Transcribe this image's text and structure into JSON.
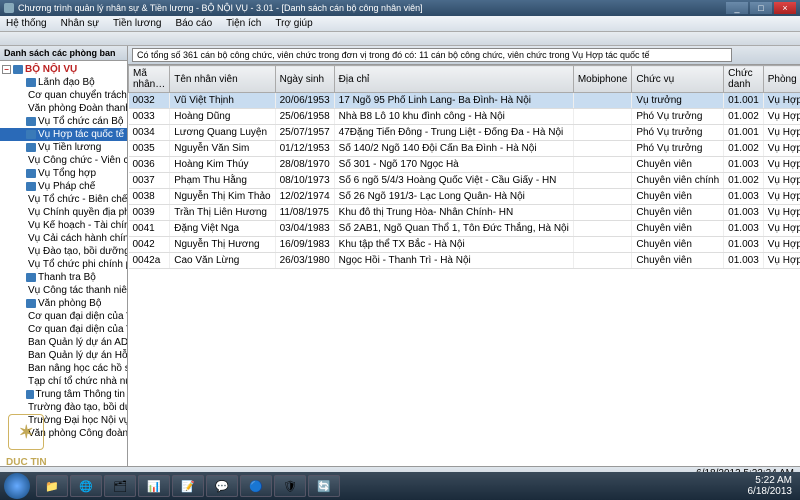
{
  "window": {
    "title": "Chương trình quản lý nhân sự & Tiền lương - BỘ NỘI VỤ - 3.01 - [Danh sách cán bộ công nhân viên]"
  },
  "menu": [
    "Hệ thống",
    "Nhân sự",
    "Tiền lương",
    "Báo cáo",
    "Tiện ích",
    "Trợ giúp"
  ],
  "sidebar": {
    "header": "Danh sách các phòng ban",
    "root": "BỘ NỘI VỤ",
    "items": [
      "Lãnh đạo Bộ",
      "Cơ quan chuyển trách của",
      "Văn phòng Đoàn thanh ni",
      "Vụ Tổ chức cán Bộ",
      "Vụ Hợp tác quốc tế",
      "Vụ Tiền lương",
      "Vụ Công chức - Viên chức",
      "Vụ Tổng hợp",
      "Vụ Pháp chế",
      "Vụ Tổ chức - Biên chế",
      "Vụ Chính quyền địa phươn",
      "Vụ Kế hoạch - Tài chính",
      "Vụ Cải cách hành chính",
      "Vụ Đào tạo, bồi dưỡng cá",
      "Vụ Tổ chức phi chính phủ",
      "Thanh tra Bộ",
      "Vụ Công tác thanh niên",
      "Văn phòng Bộ",
      "Cơ quan đại diện của Văn p",
      "Cơ quan đại diện của Văn p",
      "Ban Quản lý dự án ADB",
      "Ban Quản lý dự án Hỗ trợ n",
      "Ban nâng học các hồ sơ h",
      "Tạp chí tổ chức nhà nước",
      "Trung tâm Thông tin",
      "Trường đào tạo, bồi dưỡn",
      "Trường Đại học Nội vụ Hà",
      "Văn phòng Công đoàn Bộ"
    ],
    "selected_index": 4
  },
  "filter": {
    "text": "Có tổng số 361 cán bộ công chức, viên chức trong đơn vị trong đó có: 11 cán bộ công chức, viên chức trong Vụ Hợp tác quốc tế"
  },
  "grid": {
    "columns": [
      "Mã nhân…",
      "Tên nhân viên",
      "Ngày sinh",
      "Địa chỉ",
      "Mobiphone",
      "Chức vụ",
      "Chức danh",
      "Phòng ban"
    ],
    "rows": [
      {
        "id": "0032",
        "name": "Vũ Việt Thịnh",
        "dob": "20/06/1953",
        "addr": "17 Ngõ 95 Phố Linh Lang- Ba Đình- Hà Nội",
        "mob": "",
        "pos": "Vụ trưởng",
        "rank": "01.001",
        "dept": "Vụ Hợp tác quốc tế"
      },
      {
        "id": "0033",
        "name": "Hoàng Dũng",
        "dob": "25/06/1958",
        "addr": "Nhà B8 Lô 10 khu đình công - Hà Nội",
        "mob": "",
        "pos": "Phó Vụ trưởng",
        "rank": "01.002",
        "dept": "Vụ Hợp tác quốc tế"
      },
      {
        "id": "0034",
        "name": "Lương Quang Luyện",
        "dob": "25/07/1957",
        "addr": "47Đặng Tiến Đông - Trung Liệt - Đống Đa - Hà Nội",
        "mob": "",
        "pos": "Phó Vụ trưởng",
        "rank": "01.001",
        "dept": "Vụ Hợp tác quốc tế"
      },
      {
        "id": "0035",
        "name": "Nguyễn Văn Sim",
        "dob": "01/12/1953",
        "addr": "Số 140/2 Ngõ 140 Đội Cấn Ba Đình - Hà Nội",
        "mob": "",
        "pos": "Phó Vụ trưởng",
        "rank": "01.002",
        "dept": "Vụ Hợp tác quốc tế"
      },
      {
        "id": "0036",
        "name": "Hoàng Kim Thúy",
        "dob": "28/08/1970",
        "addr": "Số 301 - Ngõ 170 Ngọc Hà",
        "mob": "",
        "pos": "Chuyên viên",
        "rank": "01.003",
        "dept": "Vụ Hợp tác quốc tế"
      },
      {
        "id": "0037",
        "name": "Phạm Thu Hằng",
        "dob": "08/10/1973",
        "addr": "Số 6 ngõ 5/4/3 Hoàng Quốc Việt - Cầu Giấy - HN",
        "mob": "",
        "pos": "Chuyên viên chính",
        "rank": "01.002",
        "dept": "Vụ Hợp tác quốc tế"
      },
      {
        "id": "0038",
        "name": "Nguyễn Thị Kim Thảo",
        "dob": "12/02/1974",
        "addr": "Số 26 Ngõ 191/3- Lạc Long Quân- Hà Nội",
        "mob": "",
        "pos": "Chuyên viên",
        "rank": "01.003",
        "dept": "Vụ Hợp tác quốc tế"
      },
      {
        "id": "0039",
        "name": "Trần Thị Liên Hương",
        "dob": "11/08/1975",
        "addr": "Khu đô thị Trung Hòa- Nhân Chính- HN",
        "mob": "",
        "pos": "Chuyên viên",
        "rank": "01.003",
        "dept": "Vụ Hợp tác quốc tế"
      },
      {
        "id": "0041",
        "name": "Đặng Việt Nga",
        "dob": "03/04/1983",
        "addr": "Số 2AB1, Ngõ Quan Thổ 1, Tôn Đức Thắng, Hà Nội",
        "mob": "",
        "pos": "Chuyên viên",
        "rank": "01.003",
        "dept": "Vụ Hợp tác quốc tế"
      },
      {
        "id": "0042",
        "name": "Nguyễn Thị Hương",
        "dob": "16/09/1983",
        "addr": "Khu tập thể TX Bắc - Hà Nội",
        "mob": "",
        "pos": "Chuyên viên",
        "rank": "01.003",
        "dept": "Vụ Hợp tác quốc tế"
      },
      {
        "id": "0042a",
        "name": "Cao Văn Lừng",
        "dob": "26/03/1980",
        "addr": "Ngọc Hồi - Thanh Trì - Hà Nội",
        "mob": "",
        "pos": "Chuyên viên",
        "rank": "01.003",
        "dept": "Vụ Hợp tác quốc tế"
      }
    ],
    "selected_row": 0
  },
  "status": {
    "text": "6/18/2013 5:22:24 AM"
  },
  "tray": {
    "time": "5:22 AM",
    "date": "6/18/2013"
  },
  "watermark": "DUC TIN",
  "taskbar_icons": [
    "📁",
    "🌐",
    "🗂",
    "📊",
    "📝",
    "💬",
    "🔵",
    "🛡",
    "🔄"
  ]
}
